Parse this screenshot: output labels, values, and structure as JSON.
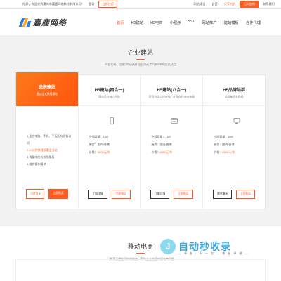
{
  "topbar": {
    "welcome": "你好，欢迎来到惠州市嘉鹿网络科技有限公司！",
    "login": "登录",
    "free_register": "立即注册",
    "links": [
      "网站建设",
      "自营",
      "分享方式"
    ],
    "wechat": "扫码加微",
    "contact": "联系我们"
  },
  "header": {
    "logo_text": "嘉鹿网络",
    "nav": [
      "首页",
      "H5建站",
      "H5电商",
      "小程序",
      "SSL",
      "网站推广",
      "建站模板",
      "合作代理"
    ],
    "active_index": 0
  },
  "section1": {
    "title": "企业建站",
    "subtitle": "不管代码，也能30分钟建设出漂亮大气的H5响应式站点"
  },
  "cards": [
    {
      "name": "选搭建站",
      "desc": "通过定式所搭建站",
      "features": [
        {
          "text": "1.适应电脑、手机、平板所有设备访问",
          "hl": false
        },
        {
          "text": "2.10分钟快速部署企业站",
          "hl": true
        },
        {
          "text": "3.海量响应式系统模板",
          "hl": false
        },
        {
          "text": "4.维护操作简单",
          "hl": false
        }
      ],
      "btn1": "可首页 ▾",
      "btn2": "立即购买"
    },
    {
      "name": "H5建站(四合一)",
      "desc": "网站设计随心所欲",
      "icon": "phone-icon",
      "space": "空间容量：10G",
      "region": "服务：国内/香港",
      "price_label": "价格：",
      "price": "5800元/年",
      "btn1": "了解详情",
      "btn2": "立即购买"
    },
    {
      "name": "H5建站(八合一)",
      "desc": "帮您的站点快速推广并保存的SEO神器",
      "icon": "browser-icon",
      "space": "空间容量：10G",
      "region": "服务：国内/香港",
      "price_label": "价格：",
      "price": "8800元/年",
      "btn1": "了解详情",
      "btn2": "立即购买"
    },
    {
      "name": "H5品牌站群",
      "desc": "站群集开发网站",
      "icon": "monitor-icon",
      "space": "空间容量：10G",
      "region": "服务：国内/香港",
      "price_label": "价格：",
      "price": "8800元/年",
      "btn1": "预览模板",
      "btn2": "立即购买"
    }
  ],
  "section2": {
    "title": "移动电商",
    "subtitle": "只需滴卫就能同你的微信、帮助企业快速实现电商网管"
  },
  "watermark": {
    "logo": "J",
    "text": "自动秒收录",
    "sub": "— 卓 越 · 不 一 次 — 曾 经 卓 越 —"
  },
  "colors": {
    "accent": "#ff5a1f"
  }
}
